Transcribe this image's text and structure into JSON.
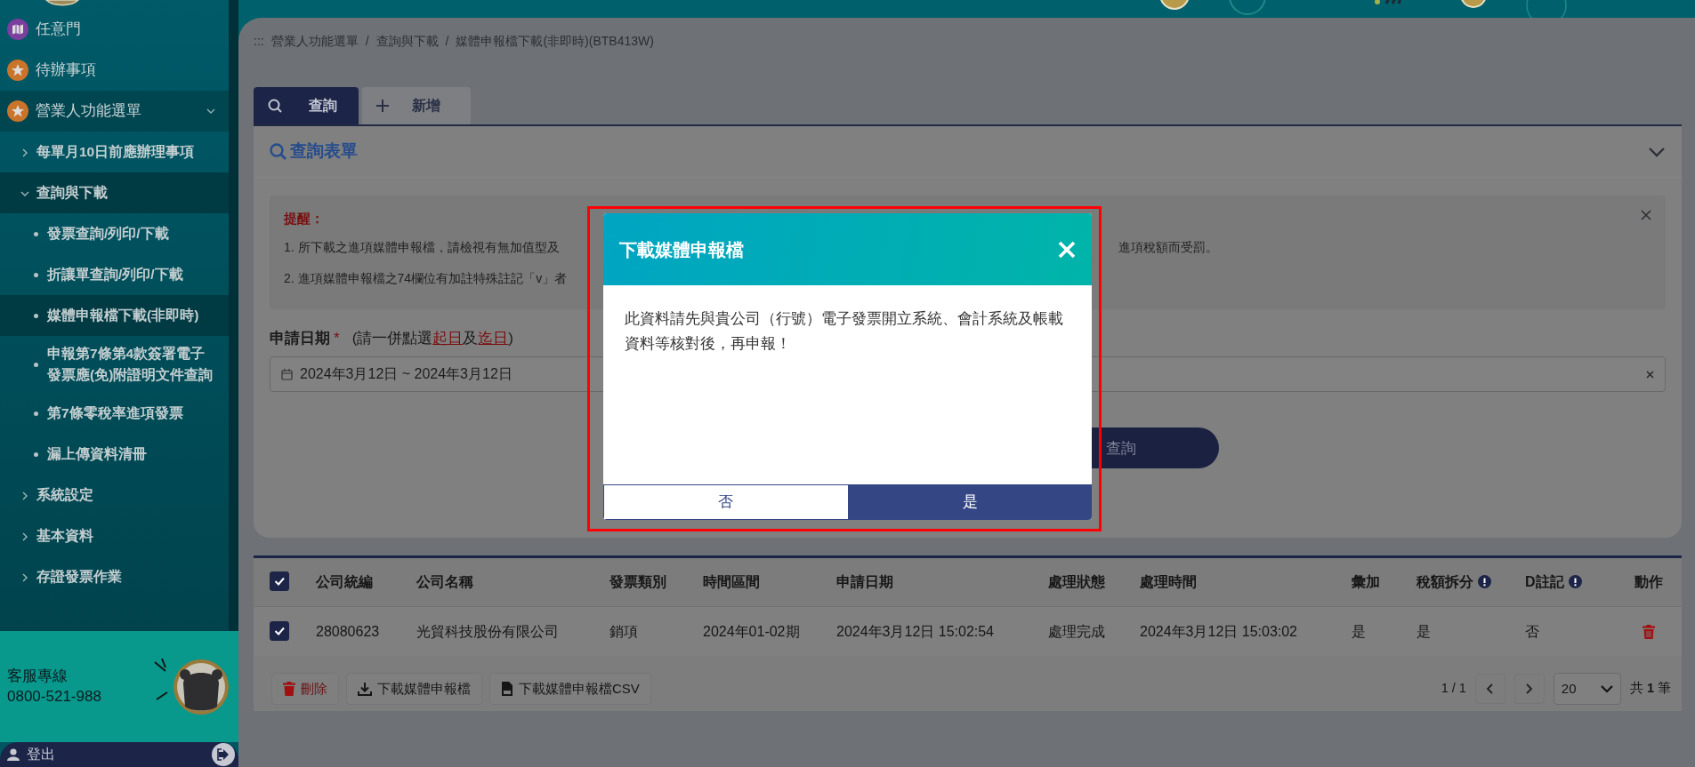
{
  "sidebar": {
    "items": [
      {
        "label": "任意門",
        "kind": "map",
        "color": "#7b3f9e"
      },
      {
        "label": "待辦事項",
        "kind": "star",
        "color": "#c9742a"
      },
      {
        "label": "營業人功能選單",
        "kind": "star",
        "color": "#c9742a",
        "expanded": true,
        "children": [
          {
            "label": "每單月10日前應辦理事項",
            "expanded": false
          },
          {
            "label": "查詢與下載",
            "expanded": true,
            "children": [
              {
                "label": "發票查詢/列印/下載",
                "selected": false
              },
              {
                "label": "折讓單查詢/列印/下載",
                "selected": false
              },
              {
                "label": "媒體申報檔下載(非即時)",
                "selected": true
              },
              {
                "label": "申報第7條第4款簽署電子發票應(免)附證明文件查詢",
                "selected": false
              },
              {
                "label": "第7條零稅率進項發票",
                "selected": false
              },
              {
                "label": "漏上傳資料清冊",
                "selected": false
              }
            ]
          },
          {
            "label": "系統設定",
            "expanded": false
          },
          {
            "label": "基本資料",
            "expanded": false
          },
          {
            "label": "存證發票作業",
            "expanded": false
          }
        ]
      }
    ],
    "hotline": {
      "label": "客服專線",
      "number": "0800-521-988"
    },
    "logout": {
      "label": "登出"
    }
  },
  "breadcrumb": {
    "prefix": ":::",
    "separator": "/",
    "items": [
      "營業人功能選單",
      "查詢與下載",
      "媒體申報檔下載(非即時)(BTB413W)"
    ]
  },
  "tabs": [
    {
      "label": "查詢",
      "kind": "search",
      "selected": true
    },
    {
      "label": "新增",
      "kind": "plus",
      "selected": false
    }
  ],
  "query_form": {
    "title": "查詢表單",
    "expanded": true,
    "reminder": {
      "title": "提醒：",
      "lines": [
        {
          "left": "1. 所下載之進項媒體申報檔，請檢視有無加值型及",
          "right": "進項稅額而受罰。"
        },
        {
          "left": "2. 進項媒體申報檔之74欄位有加註特殊註記「v」者"
        }
      ]
    },
    "date_field": {
      "label": "申請日期",
      "required_mark": "*",
      "hint_before": "(請一併點選",
      "hint_link_1": "起日",
      "hint_middle": "及",
      "hint_link_2": "迄日",
      "hint_after": ")",
      "value": "2024年3月12日 ~ 2024年3月12日"
    },
    "query_button": "查詢"
  },
  "table": {
    "select_all": true,
    "columns": [
      {
        "label": "公司統編"
      },
      {
        "label": "公司名稱"
      },
      {
        "label": "發票類別"
      },
      {
        "label": "時間區間"
      },
      {
        "label": "申請日期"
      },
      {
        "label": "處理狀態"
      },
      {
        "label": "處理時間"
      },
      {
        "label": "彙加"
      },
      {
        "label": "稅額拆分",
        "info": true
      },
      {
        "label": "D註記",
        "info": true
      },
      {
        "label": "動作"
      }
    ],
    "rows": [
      {
        "checked": true,
        "cells": [
          "28080623",
          "光貿科技股份有限公司",
          "銷項",
          "2024年01-02期",
          "2024年3月12日 15:02:54",
          "處理完成",
          "2024年3月12日 15:03:02",
          "是",
          "是",
          "否"
        ]
      }
    ]
  },
  "actions": [
    {
      "label": "刪除",
      "kind": "delete"
    },
    {
      "label": "下載媒體申報檔",
      "kind": "download"
    },
    {
      "label": "下載媒體申報檔CSV",
      "kind": "csv"
    }
  ],
  "pagination": {
    "page": "1 / 1",
    "page_size": "20",
    "total": "共 **1** 筆"
  },
  "modal": {
    "title": "下載媒體申報檔",
    "body": "此資料請先與貴公司（行號）電子發票開立系統、會計系統及帳載資料等核對後，再申報！",
    "buttons": [
      {
        "label": "否",
        "kind": "secondary"
      },
      {
        "label": "是",
        "kind": "primary"
      }
    ]
  }
}
